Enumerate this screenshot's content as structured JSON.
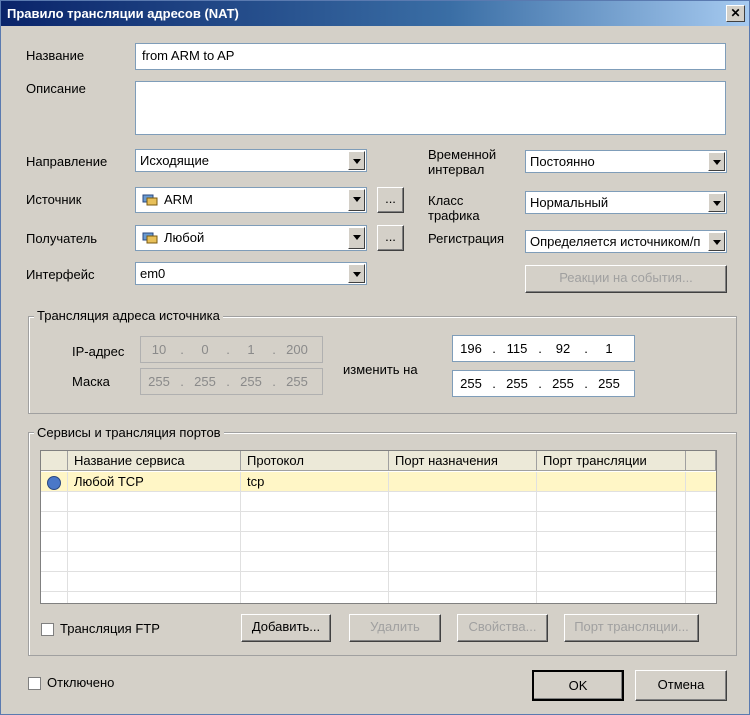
{
  "window": {
    "title": "Правило трансляции адресов (NAT)",
    "close_glyph": "✕"
  },
  "form": {
    "name_label": "Название",
    "name_value": "from ARM to AP",
    "description_label": "Описание",
    "description_value": "",
    "direction_label": "Направление",
    "direction_value": "Исходящие",
    "source_label": "Источник",
    "source_value": "ARM",
    "recipient_label": "Получатель",
    "recipient_value": "Любой",
    "interface_label": "Интерфейс",
    "interface_value": "em0",
    "browse_label": "...",
    "time_interval_label_1": "Временной",
    "time_interval_label_2": "интервал",
    "time_interval_value": "Постоянно",
    "traffic_class_label_1": "Класс",
    "traffic_class_label_2": "трафика",
    "traffic_class_value": "Нормальный",
    "registration_label": "Регистрация",
    "registration_value": "Определяется источником/п",
    "event_reactions_button": "Реакции на события..."
  },
  "source_translation": {
    "title": "Трансляция адреса источника",
    "ip_label": "IP-адрес",
    "ip_octets": [
      "10",
      "0",
      "1",
      "200"
    ],
    "mask_label": "Маска",
    "mask_octets": [
      "255",
      "255",
      "255",
      "255"
    ],
    "change_to_label": "изменить на",
    "new_ip_octets": [
      "196",
      "115",
      "92",
      "1"
    ],
    "new_mask_octets": [
      "255",
      "255",
      "255",
      "255"
    ]
  },
  "services": {
    "title": "Сервисы и трансляция портов",
    "columns": [
      "Название сервиса",
      "Протокол",
      "Порт назначения",
      "Порт трансляции"
    ],
    "rows": [
      {
        "name": "Любой TCP",
        "protocol": "tcp",
        "dest_port": "",
        "trans_port": ""
      }
    ],
    "ftp_label": "Трансляция FTP",
    "add_button": "Добавить...",
    "delete_button": "Удалить",
    "properties_button": "Свойства...",
    "port_translation_button": "Порт трансляции..."
  },
  "footer": {
    "disabled_label": "Отключено",
    "ok_button": "OK",
    "cancel_button": "Отмена"
  },
  "colors": {
    "titlebar_start": "#0a246a",
    "titlebar_end": "#a6caf0",
    "selected_row": "#fff6c6",
    "dialog_bg": "#d4d0c8"
  }
}
